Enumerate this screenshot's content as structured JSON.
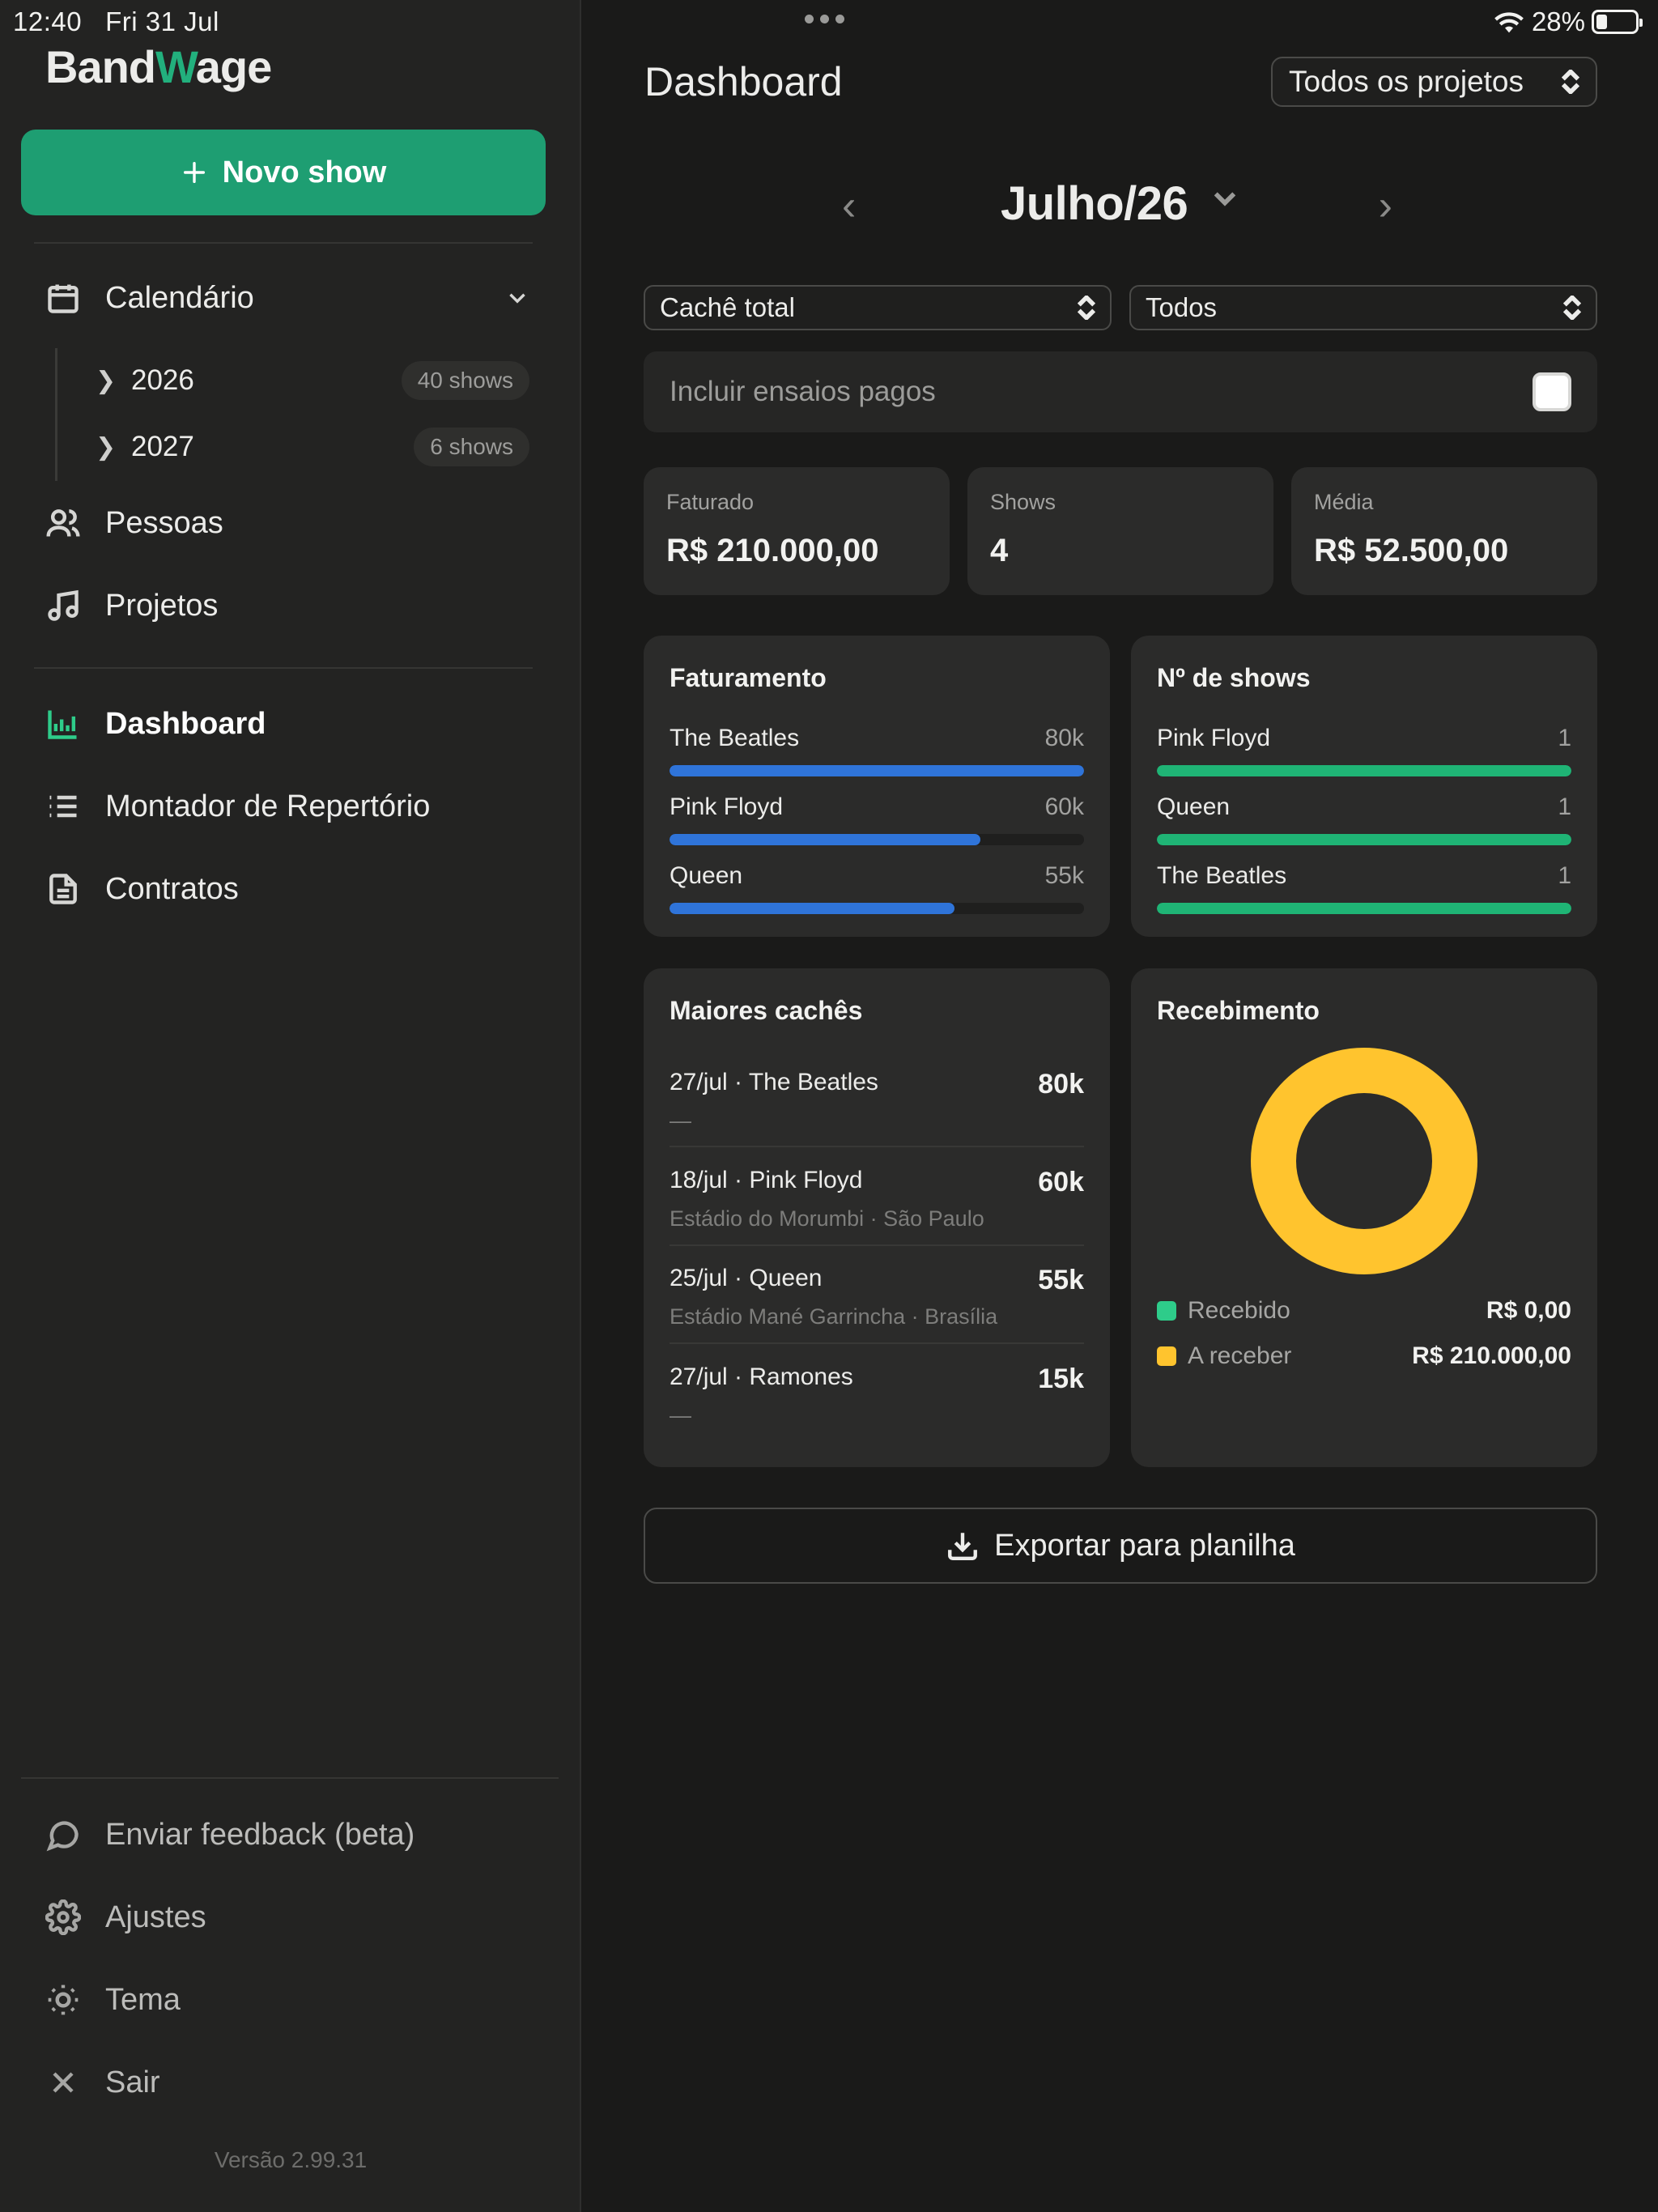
{
  "status": {
    "time": "12:40",
    "date": "Fri 31 Jul",
    "battery": "28%",
    "battery_level": 0.28
  },
  "sidebar": {
    "logo_prefix": "Band",
    "logo_accent": "W",
    "logo_suffix": "age",
    "new_show_label": "Novo show",
    "calendar_label": "Calendário",
    "years": [
      {
        "label": "2026",
        "count": "40 shows"
      },
      {
        "label": "2027",
        "count": "6 shows"
      }
    ],
    "people_label": "Pessoas",
    "projects_label": "Projetos",
    "dashboard_label": "Dashboard",
    "repertoire_label": "Montador de Repertório",
    "contracts_label": "Contratos",
    "feedback_label": "Enviar feedback (beta)",
    "settings_label": "Ajustes",
    "theme_label": "Tema",
    "logout_label": "Sair",
    "version": "Versão 2.99.31"
  },
  "main": {
    "title": "Dashboard",
    "project_filter": "Todos os projetos",
    "month": "Julho/26",
    "metric_filter": "Cachê total",
    "status_filter": "Todos",
    "include_paid_rehearsals": "Incluir ensaios pagos",
    "stats": [
      {
        "label": "Faturado",
        "value": "R$ 210.000,00"
      },
      {
        "label": "Shows",
        "value": "4"
      },
      {
        "label": "Média",
        "value": "R$ 52.500,00"
      }
    ],
    "revenue_card": {
      "title": "Faturamento",
      "rows": [
        {
          "name": "The Beatles",
          "value": "80k",
          "fraction": 1.0
        },
        {
          "name": "Pink Floyd",
          "value": "60k",
          "fraction": 0.75
        },
        {
          "name": "Queen",
          "value": "55k",
          "fraction": 0.6875
        }
      ]
    },
    "shows_card": {
      "title": "Nº de shows",
      "rows": [
        {
          "name": "Pink Floyd",
          "value": "1",
          "fraction": 1.0
        },
        {
          "name": "Queen",
          "value": "1",
          "fraction": 1.0
        },
        {
          "name": "The Beatles",
          "value": "1",
          "fraction": 1.0
        }
      ]
    },
    "top_fees_card": {
      "title": "Maiores cachês",
      "rows": [
        {
          "title": "27/jul · The Beatles",
          "amount": "80k",
          "sub": "—"
        },
        {
          "title": "18/jul · Pink Floyd",
          "amount": "60k",
          "sub": "Estádio do Morumbi · São Paulo"
        },
        {
          "title": "25/jul · Queen",
          "amount": "55k",
          "sub": "Estádio Mané Garrincha · Brasília"
        },
        {
          "title": "27/jul · Ramones",
          "amount": "15k",
          "sub": "—"
        }
      ]
    },
    "receipt_card": {
      "title": "Recebimento",
      "legend": [
        {
          "label": "Recebido",
          "amount": "R$ 0,00",
          "color": "#2ecc8a",
          "value": 0
        },
        {
          "label": "A receber",
          "amount": "R$ 210.000,00",
          "color": "#ffc42e",
          "value": 210000
        }
      ]
    },
    "export_label": "Exportar para planilha"
  },
  "colors": {
    "accent": "#1e9e72",
    "revenue_bar": "#2f74d9",
    "shows_bar": "#1fb475",
    "receivable": "#ffc42e",
    "received": "#2ecc8a"
  }
}
